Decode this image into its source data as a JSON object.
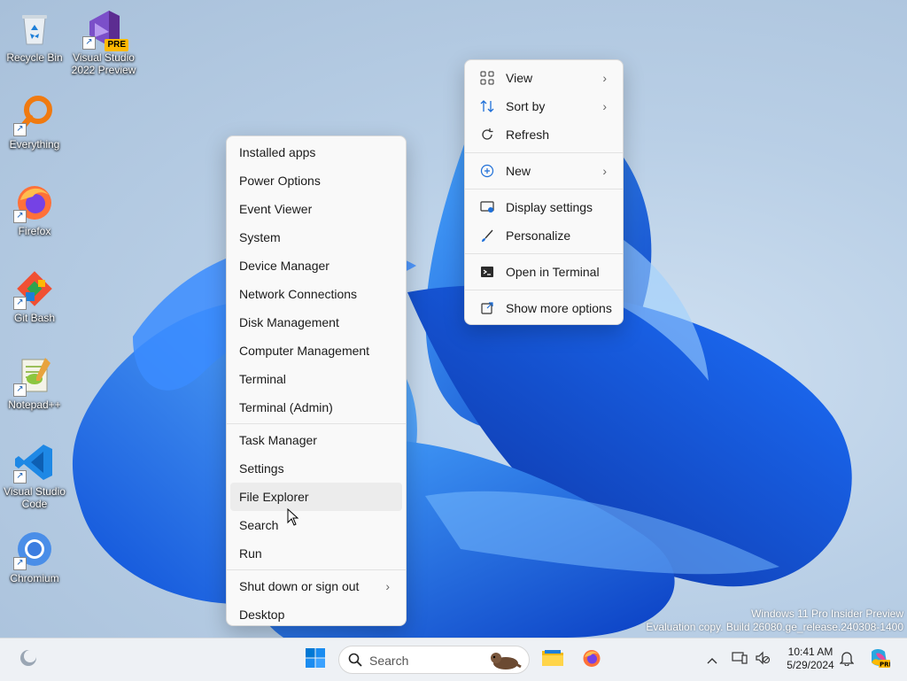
{
  "desktop_icons": [
    {
      "label": "Recycle Bin",
      "icon": "recycle-bin-icon"
    },
    {
      "label": "Visual Studio 2022 Preview",
      "icon": "visual-studio-preview-icon",
      "badge": "PRE"
    },
    {
      "label": "Everything",
      "icon": "everything-search-icon"
    },
    {
      "label": "Firefox",
      "icon": "firefox-icon"
    },
    {
      "label": "Git Bash",
      "icon": "git-bash-icon"
    },
    {
      "label": "Notepad++",
      "icon": "notepadpp-icon"
    },
    {
      "label": "Visual Studio Code",
      "icon": "vscode-icon"
    },
    {
      "label": "Chromium",
      "icon": "chromium-icon"
    }
  ],
  "winx_menu": {
    "items": [
      {
        "label": "Installed apps"
      },
      {
        "label": "Power Options"
      },
      {
        "label": "Event Viewer"
      },
      {
        "label": "System"
      },
      {
        "label": "Device Manager"
      },
      {
        "label": "Network Connections"
      },
      {
        "label": "Disk Management"
      },
      {
        "label": "Computer Management"
      },
      {
        "label": "Terminal"
      },
      {
        "label": "Terminal (Admin)"
      },
      {
        "label": "Task Manager"
      },
      {
        "label": "Settings"
      },
      {
        "label": "File Explorer"
      },
      {
        "label": "Search"
      },
      {
        "label": "Run"
      },
      {
        "label": "Shut down or sign out"
      },
      {
        "label": "Desktop"
      }
    ]
  },
  "desktop_menu": {
    "items": [
      {
        "label": "View",
        "icon": "grid-icon"
      },
      {
        "label": "Sort by",
        "icon": "sort-icon"
      },
      {
        "label": "Refresh",
        "icon": "refresh-icon"
      },
      {
        "label": "New",
        "icon": "plus-circle-icon"
      },
      {
        "label": "Display settings",
        "icon": "display-icon"
      },
      {
        "label": "Personalize",
        "icon": "brush-icon"
      },
      {
        "label": "Open in Terminal",
        "icon": "terminal-icon"
      },
      {
        "label": "Show more options",
        "icon": "open-external-icon"
      }
    ]
  },
  "taskbar": {
    "search_placeholder": "Search",
    "time": "10:41 AM",
    "date": "5/29/2024"
  },
  "watermark": {
    "line1": "Windows 11 Pro Insider Preview",
    "line2": "Evaluation copy. Build 26080.ge_release.240308-1400"
  },
  "colors": {
    "accent": "#0067c0",
    "menu_bg": "#f9f9f9",
    "taskbar_bg": "#eef1f5"
  }
}
